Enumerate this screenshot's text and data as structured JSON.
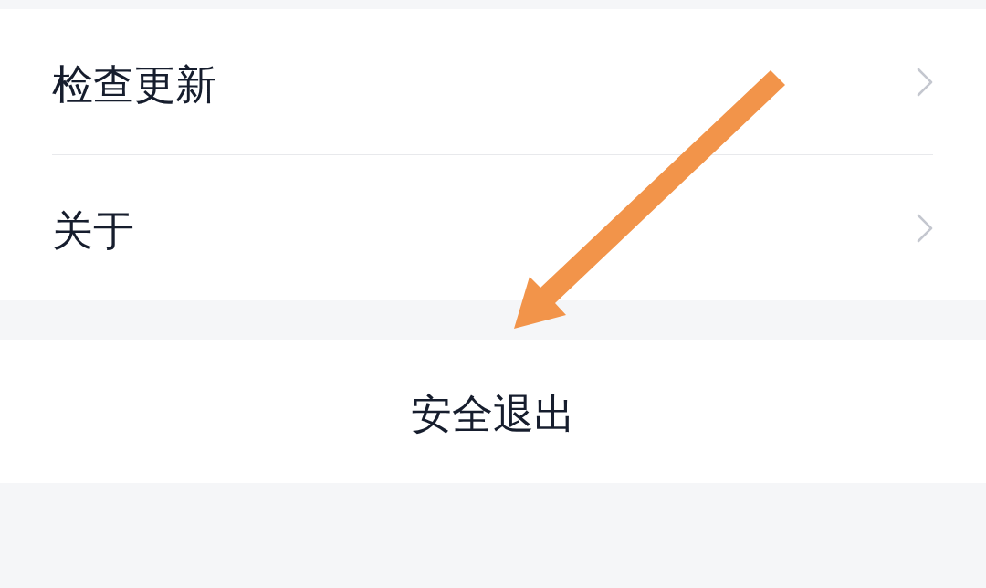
{
  "settings_list": [
    {
      "label": "检查更新"
    },
    {
      "label": "关于"
    }
  ],
  "logout_button": {
    "label": "安全退出"
  },
  "annotations": [
    {
      "kind": "arrow"
    }
  ]
}
